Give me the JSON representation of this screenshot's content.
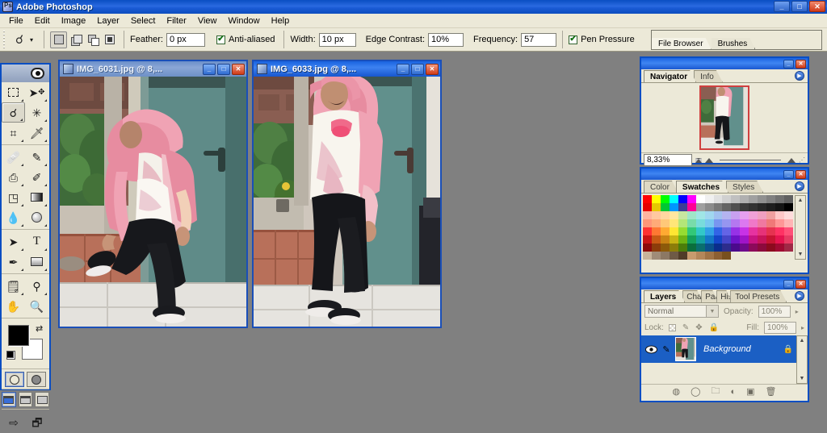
{
  "app": {
    "title": "Adobe Photoshop",
    "icon": "photoshop-icon",
    "window_buttons": {
      "minimize": "_",
      "maximize": "□",
      "close": "✕"
    }
  },
  "menubar": {
    "items": [
      "File",
      "Edit",
      "Image",
      "Layer",
      "Select",
      "Filter",
      "View",
      "Window",
      "Help"
    ]
  },
  "options_bar": {
    "tool_icon": "magnetic-lasso-icon",
    "tool_dropdown": "▾",
    "selection_modes": [
      "new-selection",
      "add-to-selection",
      "subtract-from-selection",
      "intersect-with-selection"
    ],
    "active_selection_mode": 0,
    "feather_label": "Feather:",
    "feather_value": "0 px",
    "antialiased_label": "Anti-aliased",
    "antialiased_checked": true,
    "width_label": "Width:",
    "width_value": "10 px",
    "edge_contrast_label": "Edge Contrast:",
    "edge_contrast_value": "10%",
    "frequency_label": "Frequency:",
    "frequency_value": "57",
    "pen_pressure_label": "Pen Pressure",
    "pen_pressure_checked": true
  },
  "palette_well": {
    "tabs": [
      "File Browser",
      "Brushes"
    ],
    "active": 0
  },
  "toolbox": {
    "tools": [
      {
        "name": "marquee-tool",
        "glyph": "▭",
        "selected": false
      },
      {
        "name": "move-tool",
        "glyph": "✥",
        "selected": false
      },
      {
        "name": "lasso-tool",
        "glyph": "🖗",
        "selected": true
      },
      {
        "name": "magic-wand-tool",
        "glyph": "✳",
        "selected": false
      },
      {
        "name": "crop-tool",
        "glyph": "⌗",
        "selected": false
      },
      {
        "name": "slice-tool",
        "glyph": "✂",
        "selected": false
      },
      {
        "name": "healing-brush-tool",
        "glyph": "✑",
        "selected": false
      },
      {
        "name": "brush-tool",
        "glyph": "✎",
        "selected": false
      },
      {
        "name": "clone-stamp-tool",
        "glyph": "⎙",
        "selected": false
      },
      {
        "name": "history-brush-tool",
        "glyph": "✐",
        "selected": false
      },
      {
        "name": "eraser-tool",
        "glyph": "◫",
        "selected": false
      },
      {
        "name": "gradient-tool",
        "glyph": "▤",
        "selected": false
      },
      {
        "name": "blur-tool",
        "glyph": "💧",
        "selected": false
      },
      {
        "name": "dodge-tool",
        "glyph": "⬤",
        "selected": false
      },
      {
        "name": "path-selection-tool",
        "glyph": "➤",
        "selected": false
      },
      {
        "name": "type-tool",
        "glyph": "T",
        "selected": false
      },
      {
        "name": "pen-tool",
        "glyph": "✒",
        "selected": false
      },
      {
        "name": "rectangle-tool",
        "glyph": "▬",
        "selected": false
      },
      {
        "name": "notes-tool",
        "glyph": "🗒",
        "selected": false
      },
      {
        "name": "eyedropper-tool",
        "glyph": "⚲",
        "selected": false
      },
      {
        "name": "hand-tool",
        "glyph": "✋",
        "selected": false
      },
      {
        "name": "zoom-tool",
        "glyph": "🔍",
        "selected": false
      }
    ],
    "foreground_color": "#000000",
    "background_color": "#ffffff",
    "quickmask_modes": [
      "standard-mode",
      "quick-mask-mode"
    ],
    "screen_modes": [
      "standard-screen-mode",
      "full-screen-with-menubar",
      "full-screen-mode"
    ],
    "active_screen_mode": 0,
    "jump_buttons": [
      "jump-to-imageready",
      "jump-to-file-browser"
    ]
  },
  "documents": [
    {
      "title": "IMG_6031.jpg @ 8,...",
      "active": false,
      "buttons": {
        "minimize": "_",
        "maximize": "□",
        "close": "✕"
      }
    },
    {
      "title": "IMG_6033.jpg @ 8,...",
      "active": true,
      "buttons": {
        "minimize": "_",
        "maximize": "□",
        "close": "✕"
      }
    }
  ],
  "navigator": {
    "tabs": [
      "Navigator",
      "Info"
    ],
    "active": 0,
    "zoom_value": "8,33%",
    "zoom_out_icon": "zoom-out-icon",
    "zoom_in_icon": "zoom-in-icon",
    "buttons": {
      "minimize": "_",
      "close": "✕"
    },
    "menu_icon": "palette-menu-icon"
  },
  "swatches": {
    "tabs": [
      "Color",
      "Swatches",
      "Styles"
    ],
    "active": 1,
    "buttons": {
      "minimize": "_",
      "close": "✕"
    },
    "menu_icon": "palette-menu-icon",
    "colors": [
      "#ff0000",
      "#ffff00",
      "#00ff00",
      "#00ffff",
      "#0000ff",
      "#ff00ff",
      "#ffffff",
      "#f0f0f0",
      "#e0e0e0",
      "#d0d0d0",
      "#c0c0c0",
      "#b0b0b0",
      "#a0a0a0",
      "#909090",
      "#808080",
      "#707070",
      "#606060",
      "#e60000",
      "#e6c800",
      "#00c832",
      "#0096ff",
      "#3c3c96",
      "#ff0096",
      "#a0a0a0",
      "#8c8c8c",
      "#787878",
      "#646464",
      "#505050",
      "#3c3c3c",
      "#323232",
      "#282828",
      "#1e1e1e",
      "#141414",
      "#000000",
      "#ffb4a0",
      "#ffc8a0",
      "#ffd7a0",
      "#ffe6a0",
      "#c8e6a0",
      "#a0e6c8",
      "#a0e6e6",
      "#a0d7f0",
      "#a0c0f0",
      "#b4b4f0",
      "#c8a0f0",
      "#e6a0f0",
      "#f0a0d7",
      "#f0a0c0",
      "#f0a0a0",
      "#ffc8c8",
      "#ffdcdc",
      "#ff9678",
      "#ffaa78",
      "#ffc878",
      "#ffe678",
      "#b4e678",
      "#78dcaa",
      "#78dcdc",
      "#78c8f0",
      "#7896f0",
      "#9696f0",
      "#b478f0",
      "#dc78f0",
      "#f078c8",
      "#f078a0",
      "#f07878",
      "#ff9696",
      "#ffb4b4",
      "#ff3232",
      "#ff7832",
      "#ffaa32",
      "#ffe632",
      "#96dc32",
      "#32c878",
      "#32c8c8",
      "#32a0e6",
      "#3264e6",
      "#6464e6",
      "#9632e6",
      "#c832e6",
      "#e632a0",
      "#e63278",
      "#e63250",
      "#ff3264",
      "#ff5078",
      "#c81414",
      "#c85a14",
      "#c88214",
      "#c8b414",
      "#6eb414",
      "#14a05a",
      "#14a0a0",
      "#1478c8",
      "#1446c8",
      "#4646c8",
      "#6e14c8",
      "#a014c8",
      "#c81482",
      "#c8145a",
      "#c81432",
      "#e61450",
      "#e63c64",
      "#8c0a0a",
      "#8c3c0a",
      "#8c5a0a",
      "#8c7d0a",
      "#4b7d0a",
      "#0a6e3c",
      "#0a6e6e",
      "#0a508c",
      "#0a2d8c",
      "#2d2d8c",
      "#4b0a8c",
      "#6e0a8c",
      "#8c0a5a",
      "#8c0a3c",
      "#8c0a1e",
      "#a00a32",
      "#a02846",
      "#c8b49b",
      "#a08c78",
      "#8c7864",
      "#6e5a46",
      "#503c28",
      "#c89b6e",
      "#b4875a",
      "#a07346",
      "#8c5f32",
      "#78501e",
      "#ece9d8",
      "#ece9d8",
      "#ece9d8",
      "#ece9d8",
      "#ece9d8",
      "#ece9d8",
      "#ece9d8"
    ]
  },
  "layers": {
    "tabs": [
      "Layers",
      "Channels",
      "Paths",
      "History",
      "Tool Presets"
    ],
    "active": 0,
    "buttons": {
      "minimize": "_",
      "close": "✕"
    },
    "menu_icon": "palette-menu-icon",
    "blend_mode": "Normal",
    "opacity_label": "Opacity:",
    "opacity_value": "100%",
    "lock_label": "Lock:",
    "lock_icons": [
      "lock-transparency-icon",
      "lock-pixels-icon",
      "lock-position-icon",
      "lock-all-icon"
    ],
    "fill_label": "Fill:",
    "fill_value": "100%",
    "items": [
      {
        "name": "Background",
        "visible": true,
        "locked": true,
        "selected": true
      }
    ],
    "footer_icons": [
      "layer-style-icon",
      "layer-mask-icon",
      "new-group-icon",
      "adjustment-layer-icon",
      "new-layer-icon",
      "delete-layer-icon"
    ]
  },
  "colors": {
    "titlebar_blue": "#1a5ad4",
    "panel_bg": "#ece9d8",
    "workspace_gray": "#808080",
    "selection_blue": "#1b5fc4"
  }
}
